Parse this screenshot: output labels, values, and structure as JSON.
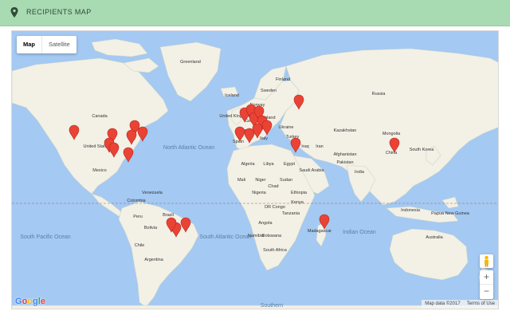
{
  "header": {
    "title": "RECIPIENTS MAP",
    "icon": "map-pin-icon"
  },
  "map_type": {
    "options": [
      "Map",
      "Satellite"
    ],
    "selected": "Map"
  },
  "zoom": {
    "in_label": "+",
    "out_label": "−"
  },
  "attribution": {
    "data": "Map data ©2017",
    "terms": "Terms of Use"
  },
  "logo": {
    "letters": [
      "G",
      "o",
      "o",
      "g",
      "l",
      "e"
    ],
    "colors": [
      "#4285f4",
      "#ea4335",
      "#fbbc05",
      "#4285f4",
      "#34a853",
      "#ea4335"
    ]
  },
  "colors": {
    "header_bg": "#a8dbb2",
    "water": "#a4c9f2",
    "land": "#f3f0e6",
    "marker": "#ea4335"
  },
  "labels": {
    "oceans": {
      "north_pacific": "North Pacific Ocean",
      "north_atlantic": "North Atlantic Ocean",
      "south_pacific": "South Pacific Ocean",
      "south_atlantic": "South Atlantic Ocean",
      "indian": "Indian Ocean",
      "southern": "Southern"
    },
    "countries": [
      "Greenland",
      "Iceland",
      "Finland",
      "Sweden",
      "Norway",
      "Russia",
      "Canada",
      "United States",
      "Mexico",
      "Venezuela",
      "Colombia",
      "Peru",
      "Brazil",
      "Bolivia",
      "Argentina",
      "Chile",
      "Ukraine",
      "Kazakhstan",
      "Mongolia",
      "China",
      "South Korea",
      "Afghanistan",
      "Pakistan",
      "India",
      "Indonesia",
      "Papua New Guinea",
      "Australia",
      "Algeria",
      "Libya",
      "Egypt",
      "Mali",
      "Niger",
      "Chad",
      "Sudan",
      "Nigeria",
      "Ethiopia",
      "Kenya",
      "DR Congo",
      "Tanzania",
      "Angola",
      "Namibia",
      "Botswana",
      "South Africa",
      "Madagascar",
      "Turkey",
      "Iraq",
      "Iran",
      "Saudi Arabia",
      "United Kingdom",
      "Spain",
      "Italy",
      "Poland",
      "Germany",
      "France"
    ]
  },
  "markers_count": 24
}
